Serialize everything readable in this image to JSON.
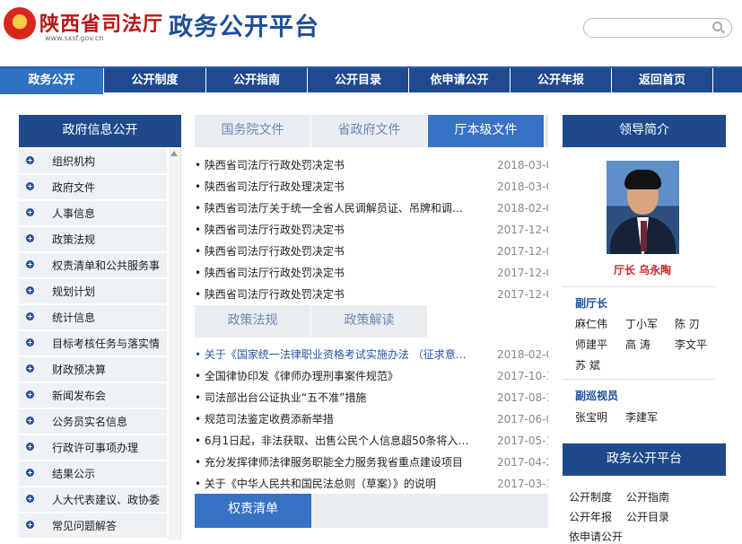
{
  "header": {
    "brand": "陕西省司法厅",
    "url": "www.sxsf.gov.cn",
    "platform": "政务公开平台",
    "search": {
      "placeholder": ""
    }
  },
  "nav": [
    "政务公开",
    "公开制度",
    "公开指南",
    "公开目录",
    "依申请公开",
    "公开年报",
    "返回首页"
  ],
  "sidebar": {
    "title": "政府信息公开",
    "items": [
      "组织机构",
      "政府文件",
      "人事信息",
      "政策法规",
      "权责清单和公共服务事",
      "规划计划",
      "统计信息",
      "目标考核任务与落实情",
      "财政预决算",
      "新闻发布会",
      "公务员实名信息",
      "行政许可事项办理",
      "结果公示",
      "人大代表建议、政协委",
      "常见问题解答"
    ]
  },
  "center": {
    "tabs": [
      "国务院文件",
      "省政府文件",
      "厅本级文件"
    ],
    "documents": [
      {
        "title": "• 陕西省司法厅行政处罚决定书",
        "date": "2018-03-0"
      },
      {
        "title": "• 陕西省司法厅行政处理决定书",
        "date": "2018-03-0"
      },
      {
        "title": "• 陕西省司法厅关于统一全省人民调解员证、吊牌和调…",
        "date": "2018-02-0"
      },
      {
        "title": "• 陕西省司法厅行政处罚决定书",
        "date": "2017-12-0"
      },
      {
        "title": "• 陕西省司法厅行政处罚决定书",
        "date": "2017-12-0"
      },
      {
        "title": "• 陕西省司法厅行政处罚决定书",
        "date": "2017-12-0"
      },
      {
        "title": "• 陕西省司法厅行政处罚决定书",
        "date": "2017-12-0"
      }
    ],
    "policy_tabs": [
      "政策法规",
      "政策解读"
    ],
    "policies": [
      {
        "title": "• 关于《国家统一法律职业资格考试实施办法 （征求意…",
        "date": "2018-02-0"
      },
      {
        "title": "• 全国律协印发《律师办理刑事案件规范》",
        "date": "2017-10-1"
      },
      {
        "title": "• 司法部出台公证执业“五不准”措施",
        "date": "2017-08-1"
      },
      {
        "title": "• 规范司法鉴定收费添新举措",
        "date": "2017-06-0"
      },
      {
        "title": "• 6月1日起，非法获取、出售公民个人信息超50条将入…",
        "date": "2017-05-1"
      },
      {
        "title": "• 充分发挥律师法律服务职能全力服务我省重点建设项目",
        "date": "2017-04-2"
      },
      {
        "title": "• 关于《中华人民共和国民法总则（草案）》的说明",
        "date": "2017-03-1"
      }
    ],
    "bottom_tab": "权责清单"
  },
  "leaders": {
    "title": "领导简介",
    "chief": "厅长 乌永陶",
    "deputy_heading": "副厅长",
    "deputies": [
      "麻仁伟",
      "丁小军",
      "陈 刃",
      "师建平",
      "高 涛",
      "李文平",
      "苏 斌"
    ],
    "inspector_heading": "副巡视员",
    "inspectors": [
      "张宝明",
      "李建军"
    ]
  },
  "platform_box": {
    "title": "政务公开平台",
    "links": [
      "公开制度",
      "公开指南",
      "公开年报",
      "公开目录",
      "依申请公开"
    ]
  }
}
